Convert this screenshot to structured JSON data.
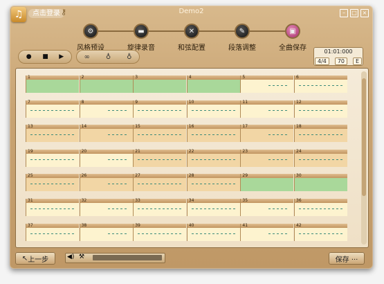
{
  "app": {
    "title": "Demo2",
    "login_label": "点击登录"
  },
  "steps": [
    {
      "label": "风格预设",
      "icon": "gear-icon"
    },
    {
      "label": "旋律录音",
      "icon": "folder-icon"
    },
    {
      "label": "和弦配置",
      "icon": "tools-icon"
    },
    {
      "label": "段落调整",
      "icon": "pencil-icon"
    },
    {
      "label": "全曲保存",
      "icon": "save-icon",
      "active": true
    }
  ],
  "transport": {
    "icons": [
      "record-icon",
      "stop-icon",
      "play-icon"
    ]
  },
  "tools": {
    "icons": [
      "link-icon",
      "bulb-icon",
      "bulb-icon"
    ]
  },
  "time": {
    "position": "01:01:000",
    "meter": "4/4",
    "tempo": "70",
    "key": "E"
  },
  "bars": [
    {
      "n": "1",
      "fill": "green"
    },
    {
      "n": "2",
      "fill": "green"
    },
    {
      "n": "3",
      "fill": "green"
    },
    {
      "n": "4",
      "fill": "green"
    },
    {
      "n": "5",
      "fill": "light"
    },
    {
      "n": "6",
      "fill": "light"
    },
    {
      "n": "7",
      "fill": "light"
    },
    {
      "n": "8",
      "fill": "light"
    },
    {
      "n": "9",
      "fill": "light"
    },
    {
      "n": "10",
      "fill": "light"
    },
    {
      "n": "11",
      "fill": "light"
    },
    {
      "n": "12",
      "fill": "light"
    },
    {
      "n": "13",
      "fill": "mid"
    },
    {
      "n": "14",
      "fill": "mid"
    },
    {
      "n": "15",
      "fill": "mid"
    },
    {
      "n": "16",
      "fill": "mid"
    },
    {
      "n": "17",
      "fill": "mid"
    },
    {
      "n": "18",
      "fill": "mid"
    },
    {
      "n": "19",
      "fill": "light"
    },
    {
      "n": "20",
      "fill": "light"
    },
    {
      "n": "21",
      "fill": "mid"
    },
    {
      "n": "22",
      "fill": "mid"
    },
    {
      "n": "23",
      "fill": "mid"
    },
    {
      "n": "24",
      "fill": "mid"
    },
    {
      "n": "25",
      "fill": "mid"
    },
    {
      "n": "26",
      "fill": "mid"
    },
    {
      "n": "27",
      "fill": "mid"
    },
    {
      "n": "28",
      "fill": "mid"
    },
    {
      "n": "29",
      "fill": "green"
    },
    {
      "n": "30",
      "fill": "green"
    },
    {
      "n": "31",
      "fill": "light"
    },
    {
      "n": "32",
      "fill": "light"
    },
    {
      "n": "33",
      "fill": "light"
    },
    {
      "n": "34",
      "fill": "light"
    },
    {
      "n": "35",
      "fill": "light"
    },
    {
      "n": "36",
      "fill": "light"
    },
    {
      "n": "37",
      "fill": "light"
    },
    {
      "n": "38",
      "fill": "light"
    },
    {
      "n": "39",
      "fill": "light"
    },
    {
      "n": "40",
      "fill": "light"
    },
    {
      "n": "41",
      "fill": "light"
    },
    {
      "n": "42",
      "fill": "light"
    }
  ],
  "footer": {
    "back_label": "上一步",
    "save_label": "保存 ···"
  },
  "colors": {
    "green": "#a9d89a",
    "light": "#fdf3cf",
    "mid": "#f2d6a5"
  }
}
